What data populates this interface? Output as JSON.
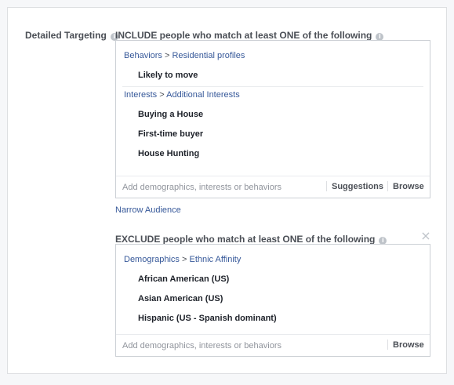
{
  "detailed_targeting": {
    "label": "Detailed Targeting",
    "info_icon": "i"
  },
  "include": {
    "header": "INCLUDE people who match at least ONE of the following",
    "info_icon": "i",
    "groups": [
      {
        "category": "Behaviors",
        "separator": ">",
        "subcategory": "Residential profiles",
        "items": [
          "Likely to move"
        ]
      },
      {
        "category": "Interests",
        "separator": ">",
        "subcategory": "Additional Interests",
        "items": [
          "Buying a House",
          "First-time buyer",
          "House Hunting"
        ]
      }
    ],
    "input_placeholder": "Add demographics, interests or behaviors",
    "suggestions_label": "Suggestions",
    "browse_label": "Browse"
  },
  "narrow_audience_label": "Narrow Audience",
  "exclude": {
    "header": "EXCLUDE people who match at least ONE of the following",
    "info_icon": "i",
    "close_icon": "×",
    "groups": [
      {
        "category": "Demographics",
        "separator": ">",
        "subcategory": "Ethnic Affinity",
        "items": [
          "African American (US)",
          "Asian American (US)",
          "Hispanic (US - Spanish dominant)"
        ]
      }
    ],
    "input_placeholder": "Add demographics, interests or behaviors",
    "browse_label": "Browse"
  },
  "colors": {
    "link": "#365899",
    "label": "#4b4f56",
    "border": "#ccd0d5",
    "background": "#f6f7f9"
  }
}
